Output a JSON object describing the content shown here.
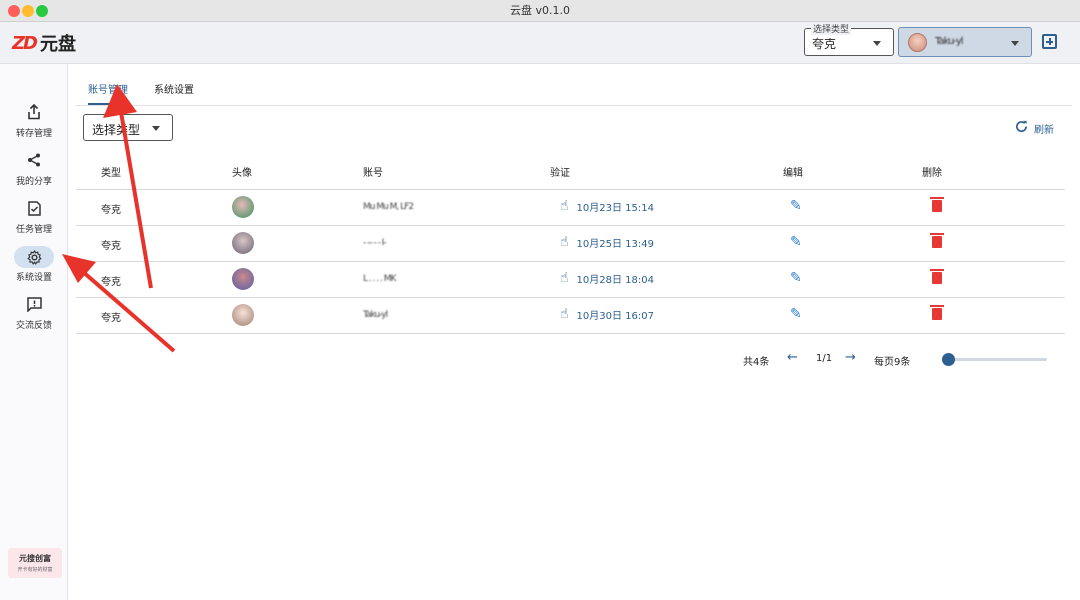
{
  "window": {
    "title": "云盘 v0.1.0"
  },
  "header": {
    "logo_mark": "ZD",
    "logo_text": "元盘",
    "type_select": {
      "legend": "选择类型",
      "value": "夸克"
    },
    "account_select": {
      "value": "Taku-yl"
    }
  },
  "sidebar": {
    "items": [
      {
        "label": "转存管理",
        "icon": "share-export-icon"
      },
      {
        "label": "我的分享",
        "icon": "share-icon"
      },
      {
        "label": "任务管理",
        "icon": "task-icon"
      },
      {
        "label": "系统设置",
        "icon": "gear-icon"
      },
      {
        "label": "交流反馈",
        "icon": "feedback-icon"
      }
    ],
    "promo": {
      "line1": "元搜创富",
      "line2": "开卡有好的财富"
    }
  },
  "tabs": [
    {
      "label": "账号管理"
    },
    {
      "label": "系统设置"
    }
  ],
  "toolbar": {
    "type_filter": "选择类型",
    "refresh_label": "刷新"
  },
  "table": {
    "headers": [
      "类型",
      "头像",
      "账号",
      "验证",
      "编辑",
      "删除"
    ],
    "rows": [
      {
        "type": "夸克",
        "account": "Mu Mu M, LF2",
        "verify": "10月23日 15:14"
      },
      {
        "type": "夸克",
        "account": "- -- - - I-",
        "verify": "10月25日 13:49"
      },
      {
        "type": "夸克",
        "account": "L . . . . MK",
        "verify": "10月28日 18:04"
      },
      {
        "type": "夸克",
        "account": "Taku-yl",
        "verify": "10月30日 16:07"
      }
    ]
  },
  "pagination": {
    "total": "共4条",
    "page": "1/1",
    "per_page": "每页9条",
    "slider_value": 0
  },
  "colors": {
    "accent": "#2d5f91",
    "delete": "#e53935",
    "annotation": "#e8332a"
  }
}
